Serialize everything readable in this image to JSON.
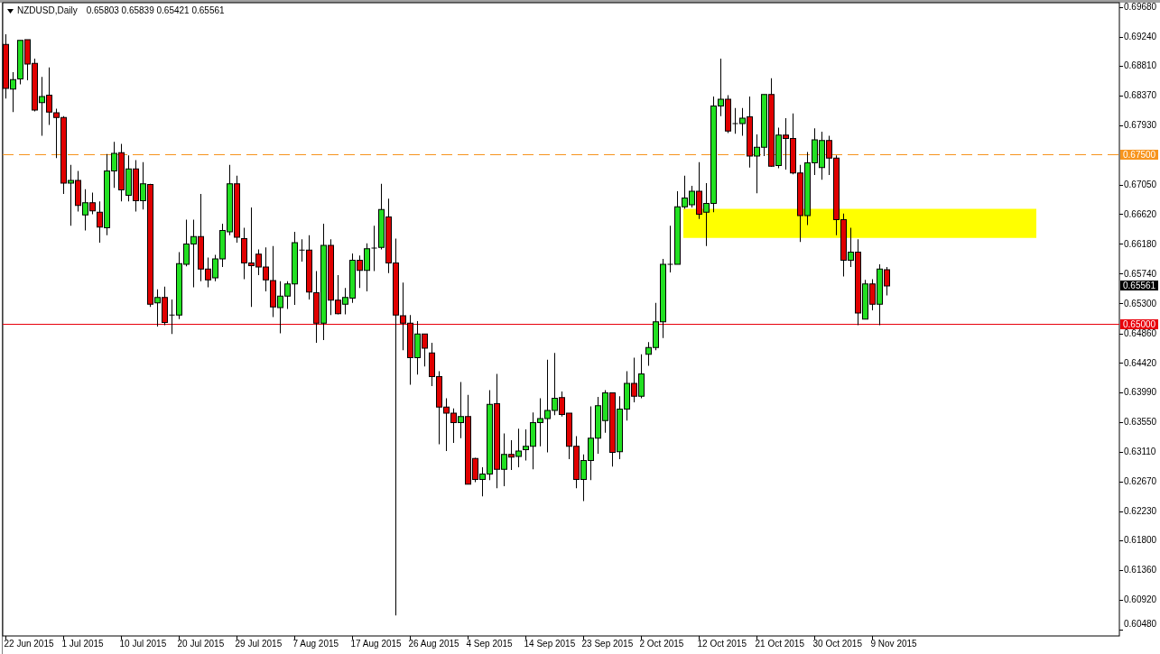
{
  "chart": {
    "header": {
      "symbol": "NZDUSD,Daily",
      "ohlc": "0.65803 0.65839 0.65421 0.65561"
    },
    "price_axis": [
      "0.69680",
      "0.69240",
      "0.68810",
      "0.68370",
      "0.67930",
      "0.67050",
      "0.66620",
      "0.66180",
      "0.65740",
      "0.65300",
      "0.64860",
      "0.64420",
      "0.63990",
      "0.63550",
      "0.63110",
      "0.62670",
      "0.62230",
      "0.61800",
      "0.61360",
      "0.60920",
      "0.60480"
    ],
    "date_axis": [
      "22 Jun 2015",
      "1 Jul 2015",
      "10 Jul 2015",
      "20 Jul 2015",
      "29 Jul 2015",
      "7 Aug 2015",
      "17 Aug 2015",
      "26 Aug 2015",
      "4 Sep 2015",
      "14 Sep 2015",
      "23 Sep 2015",
      "2 Oct 2015",
      "12 Oct 2015",
      "21 Oct 2015",
      "30 Oct 2015",
      "9 Nov 2015"
    ],
    "level_lines": [
      {
        "kind": "dashed",
        "label": "0.67500",
        "color": "#f7941d"
      },
      {
        "kind": "price",
        "label": "0.65561",
        "color": "#000000"
      },
      {
        "kind": "solid",
        "label": "0.65000",
        "color": "#e8000b"
      }
    ]
  }
}
